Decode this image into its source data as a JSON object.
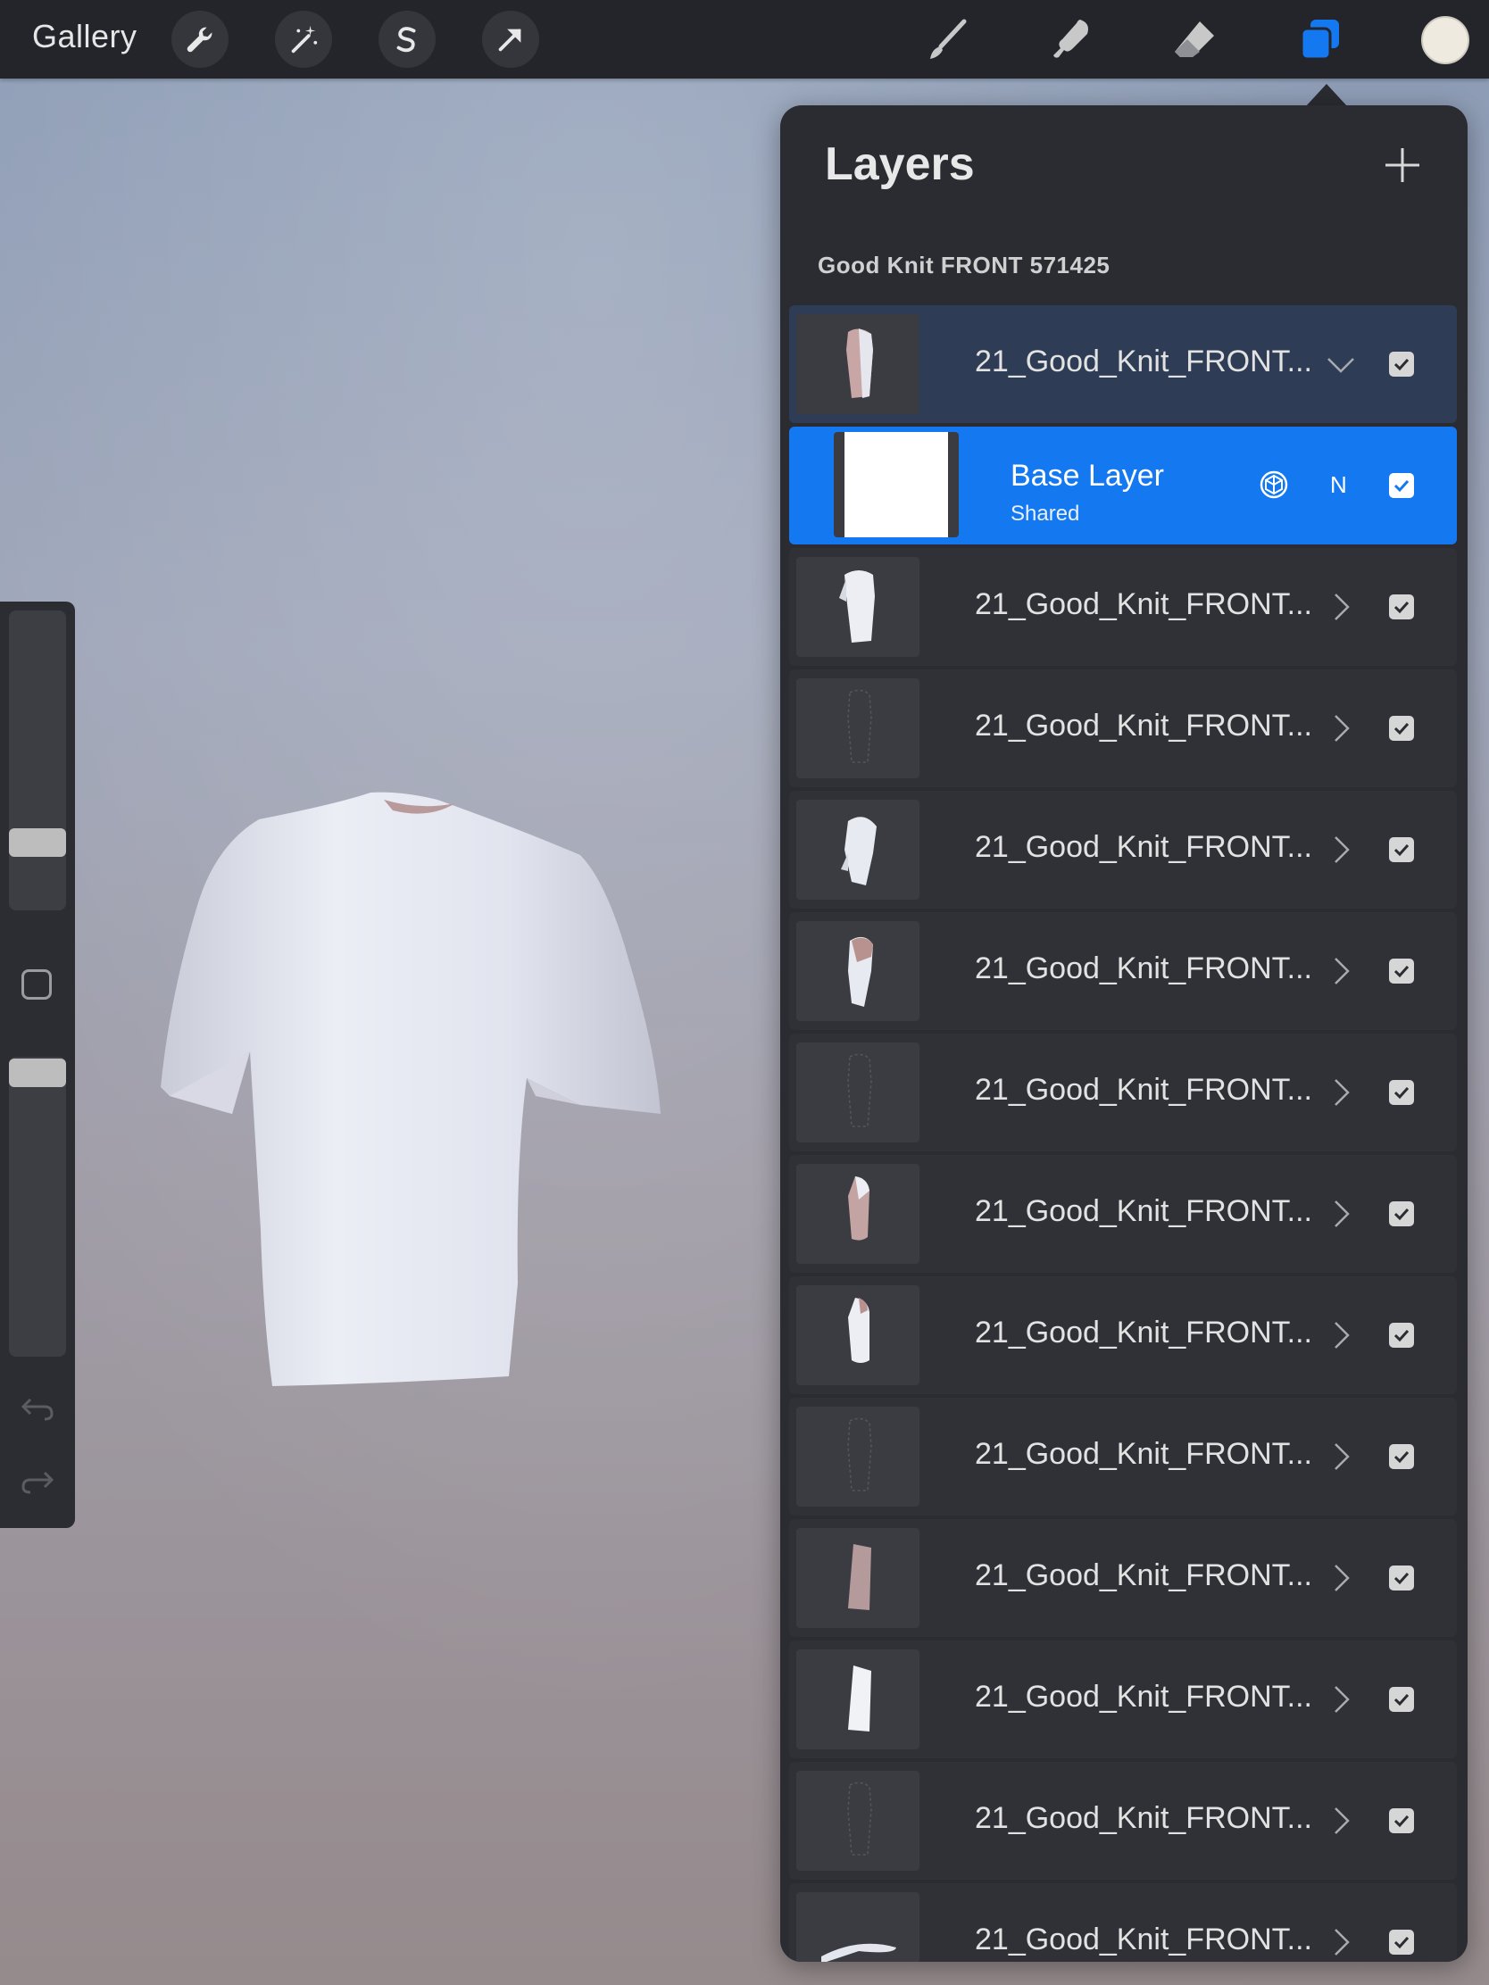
{
  "toolbar": {
    "gallery_label": "Gallery",
    "left_tools": [
      "wrench-icon",
      "magic-wand-icon",
      "selection-s-icon",
      "transform-arrow-icon"
    ],
    "right_tools": [
      "brush-icon",
      "smudge-icon",
      "eraser-icon",
      "layers-icon"
    ],
    "active_tool": "layers-icon",
    "active_color": "#eeeadf",
    "accent_color": "#1478f0"
  },
  "sidebar": {
    "brush_size_level": 0.25,
    "opacity_level": 0.95
  },
  "layers_panel": {
    "title": "Layers",
    "group_name": "Good Knit FRONT 571425",
    "group_row": {
      "name": "21_Good_Knit_FRONT...",
      "expanded": true,
      "visible": true
    },
    "selected_layer": {
      "name": "Base Layer",
      "subtitle": "Shared",
      "blend_mode": "N",
      "visible": true
    },
    "layers": [
      {
        "name": "21_Good_Knit_FRONT...",
        "thumb": "white-shirt",
        "visible": true
      },
      {
        "name": "21_Good_Knit_FRONT...",
        "thumb": "outline",
        "visible": true
      },
      {
        "name": "21_Good_Knit_FRONT...",
        "thumb": "white-shirt-side",
        "visible": true
      },
      {
        "name": "21_Good_Knit_FRONT...",
        "thumb": "pink-shirt-side",
        "visible": true
      },
      {
        "name": "21_Good_Knit_FRONT...",
        "thumb": "outline",
        "visible": true
      },
      {
        "name": "21_Good_Knit_FRONT...",
        "thumb": "sleeve-pink",
        "visible": true
      },
      {
        "name": "21_Good_Knit_FRONT...",
        "thumb": "sleeve-white",
        "visible": true
      },
      {
        "name": "21_Good_Knit_FRONT...",
        "thumb": "outline",
        "visible": true
      },
      {
        "name": "21_Good_Knit_FRONT...",
        "thumb": "panel-pink",
        "visible": true
      },
      {
        "name": "21_Good_Knit_FRONT...",
        "thumb": "panel-white",
        "visible": true
      },
      {
        "name": "21_Good_Knit_FRONT...",
        "thumb": "outline",
        "visible": true
      },
      {
        "name": "21_Good_Knit_FRONT...",
        "thumb": "collar",
        "visible": true
      }
    ]
  }
}
